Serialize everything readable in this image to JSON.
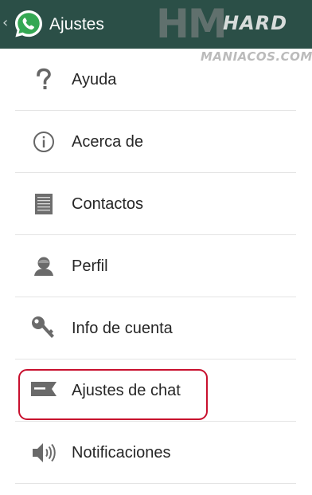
{
  "appbar": {
    "title": "Ajustes",
    "back_icon": "chevron-left-icon",
    "logo_icon": "whatsapp-logo-icon",
    "background_color": "#2b4f47"
  },
  "watermark": {
    "logo_text": "HM",
    "line1": "HARD",
    "line2": "MANIACOS.COM"
  },
  "menu": {
    "items": [
      {
        "label": "Ayuda",
        "icon": "help-question-icon"
      },
      {
        "label": "Acerca de",
        "icon": "info-icon"
      },
      {
        "label": "Contactos",
        "icon": "contacts-list-icon"
      },
      {
        "label": "Perfil",
        "icon": "profile-person-icon"
      },
      {
        "label": "Info de cuenta",
        "icon": "key-icon"
      },
      {
        "label": "Ajustes de chat",
        "icon": "chat-icon"
      },
      {
        "label": "Notificaciones",
        "icon": "speaker-icon"
      }
    ]
  },
  "highlight": {
    "target": "Ajustes de chat",
    "color": "#c8102e"
  }
}
